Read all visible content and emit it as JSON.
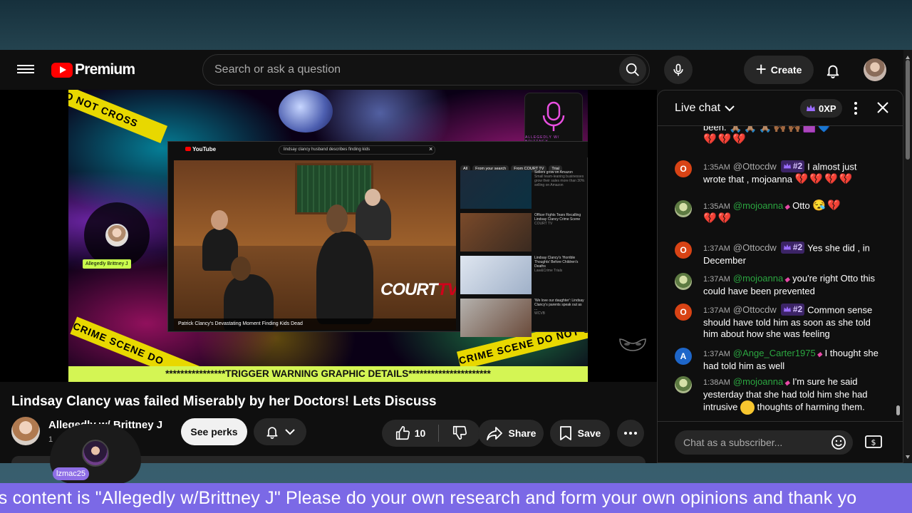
{
  "masthead": {
    "logo_text": "Premium",
    "search_placeholder": "Search or ask a question",
    "create_label": "Create"
  },
  "video": {
    "inner_search_text": "lindsay clancy husband describes finding kids",
    "inner_logo_text": "YouTube",
    "inner_chips": [
      "All",
      "From your search",
      "From COURT TV",
      "Trial"
    ],
    "inner_caption": "Patrick Clancy's Devastating Moment Finding Kids Dead",
    "courttv_text": "COURT",
    "courttv_accent": "TV",
    "sidebar_items": [
      {
        "title": "Sellers grow on Amazon",
        "meta": "Small team-leaning businesses grow their sales more than 30% selling on Amazon"
      },
      {
        "title": "Officer Fights Tears Recalling Lindsay Clancy Crime Scene",
        "meta": "COURT TV"
      },
      {
        "title": "Lindsay Clancy's 'Horrible Thoughts' Before Children's Deaths",
        "meta": "Law&Crime Trials"
      },
      {
        "title": "'We love our daughter': Lindsay Clancy's parents speak out as ...",
        "meta": "WCVB"
      }
    ],
    "podcast_sub": "ALLEGEDLY W/ BRITTNEY",
    "host_tag": "Allegedly Brittney J",
    "tape_texts": [
      "DO NOT CROSS",
      "CRIME SCENE DO",
      "CRIME SCENE DO NOT CROSS"
    ],
    "trigger_text": "****************TRIGGER WARNING GRAPHIC DETAILS**********************"
  },
  "details": {
    "title": "Lindsay Clancy was failed Miserably by her Doctors! Lets Discuss",
    "channel_name": "Allegedly w/ Brittney J",
    "subs_text": "1",
    "perks_label": "See perks",
    "like_count": "10",
    "share_label": "Share",
    "save_label": "Save"
  },
  "chat": {
    "title": "Live chat",
    "xp_label": "0XP",
    "input_placeholder": "Chat as a subscriber...",
    "messages": [
      {
        "text": "been.",
        "partial": true
      },
      {
        "time": "1:35AM",
        "author": "@Ottocdw",
        "badge": "#2",
        "text": "I almost just wrote that , mojoanna"
      },
      {
        "time": "1:35AM",
        "author": "@mojoanna",
        "text": "Otto"
      },
      {
        "time": "1:37AM",
        "author": "@Ottocdw",
        "badge": "#2",
        "text": "Yes she did , in December"
      },
      {
        "time": "1:37AM",
        "author": "@mojoanna",
        "text": "you're right Otto this could have been prevented"
      },
      {
        "time": "1:37AM",
        "author": "@Ottocdw",
        "badge": "#2",
        "text": "Common sense should have told him as soon as she told him about how she was feeling"
      },
      {
        "time": "1:37AM",
        "author": "@Ange_Carter1975",
        "text": "I thought she had told him as well"
      },
      {
        "time": "1:38AM",
        "author": "@mojoanna",
        "text_a": "I'm sure he said yesterday that she had told him she had intrusive",
        "text_b": "thoughts of harming them."
      }
    ],
    "avatar_letters": {
      "otto": "O",
      "ange": "A"
    }
  },
  "overlay": {
    "viewer_tag": "lzmac25"
  },
  "ticker": {
    "text": "is content is \"Allegedly w/Brittney J\" Please do your own research and form your own opinions and thank yo"
  },
  "colors": {
    "brand_red": "#ff0000",
    "ticker_bg": "#7b69e6",
    "trigger_bg": "#d4f554",
    "member_green": "#2ba640",
    "heart_red": "#e0245e"
  }
}
